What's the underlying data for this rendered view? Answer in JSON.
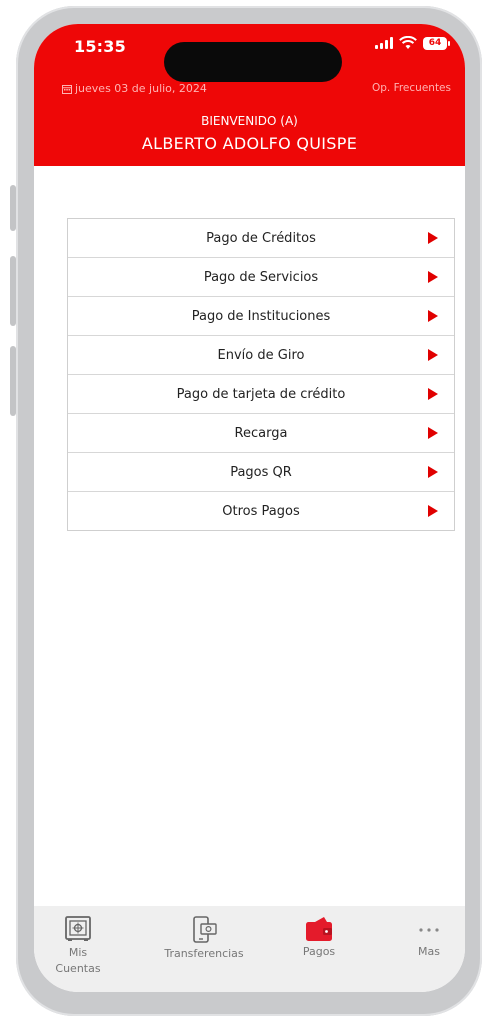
{
  "status_bar": {
    "time": "15:35",
    "battery": "64"
  },
  "header": {
    "date": "jueves 03 de julio, 2024",
    "frequent_ops": "Op. Frecuentes",
    "welcome": "BIENVENIDO (A)",
    "user_name": "ALBERTO ADOLFO QUISPE",
    "bg_color": "#ee0707"
  },
  "menu": {
    "items": [
      {
        "label": "Pago de Créditos"
      },
      {
        "label": "Pago de Servicios"
      },
      {
        "label": "Pago de Instituciones"
      },
      {
        "label": "Envío de Giro"
      },
      {
        "label": "Pago de tarjeta de crédito"
      },
      {
        "label": "Recarga"
      },
      {
        "label": "Pagos QR"
      },
      {
        "label": "Otros Pagos"
      }
    ],
    "arrow_icon": "play-arrow-icon",
    "arrow_color": "#e00000"
  },
  "tabbar": {
    "tabs": [
      {
        "label": "Mis Cuentas",
        "icon": "safe-icon",
        "active": false
      },
      {
        "label": "Transferencias",
        "icon": "phone-transfer-icon",
        "active": false
      },
      {
        "label": "Pagos",
        "icon": "wallet-icon",
        "active": true
      },
      {
        "label": "Mas",
        "icon": "more-dots-icon",
        "active": false
      }
    ],
    "active_color": "#e41b2b"
  }
}
